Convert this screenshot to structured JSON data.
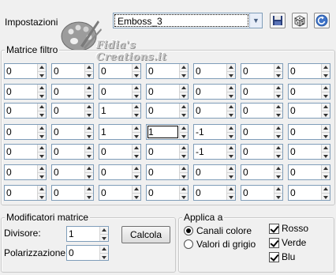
{
  "header": {
    "preset_label": "Impostazioni",
    "preset_value": "Emboss_3",
    "watermark": "Fidia's Creations.it",
    "toolbar_icons": [
      "save-icon",
      "randomize-dice-icon",
      "reset-icon"
    ]
  },
  "matrix": {
    "title": "Matrice filtro",
    "rows": [
      [
        "0",
        "0",
        "0",
        "0",
        "0",
        "0",
        "0"
      ],
      [
        "0",
        "0",
        "0",
        "0",
        "0",
        "0",
        "0"
      ],
      [
        "0",
        "0",
        "1",
        "0",
        "0",
        "0",
        "0"
      ],
      [
        "0",
        "0",
        "1",
        "1",
        "-1",
        "0",
        "0"
      ],
      [
        "0",
        "0",
        "0",
        "0",
        "-1",
        "0",
        "0"
      ],
      [
        "0",
        "0",
        "0",
        "0",
        "0",
        "0",
        "0"
      ],
      [
        "0",
        "0",
        "0",
        "0",
        "0",
        "0",
        "0"
      ]
    ],
    "focused_cell": [
      3,
      3
    ]
  },
  "modifiers": {
    "title": "Modificatori matrice",
    "divisor_label": "Divisore:",
    "divisor_value": "1",
    "compute_label": "Calcola",
    "bias_label": "Polarizzazione:",
    "bias_value": "0"
  },
  "apply": {
    "title": "Applica a",
    "radio_color": "Canali colore",
    "radio_gray": "Valori di grigio",
    "selected": "Canali colore",
    "red": "Rosso",
    "green": "Verde",
    "blue": "Blu",
    "red_checked": true,
    "green_checked": true,
    "blue_checked": true
  }
}
